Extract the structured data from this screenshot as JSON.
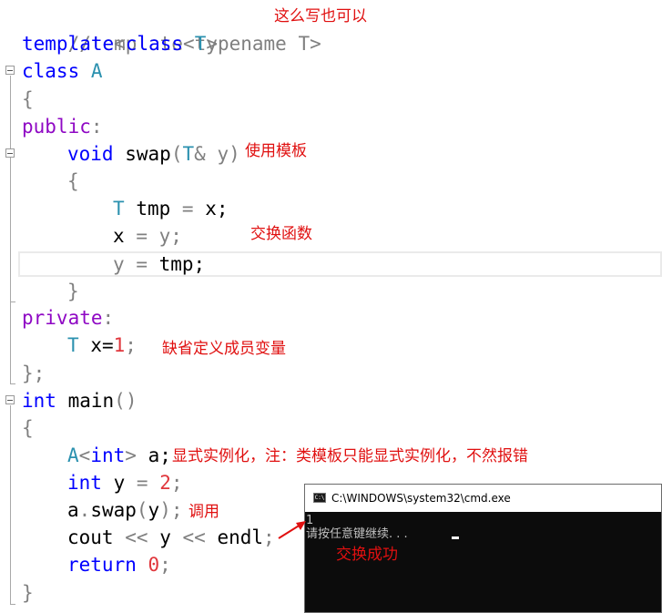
{
  "code": {
    "l1": "//template<typename T>",
    "l2_kw": "template",
    "l2_rest": "<class T>",
    "l3_kw": "class",
    "l3_name": "A",
    "l4": "{",
    "l5_kw": "public",
    "l5_colon": ":",
    "l6_kw": "void",
    "l6_fn": "swap",
    "l6_p1": "(",
    "l6_t": "T",
    "l6_amp": "&",
    "l6_y": "y",
    "l6_p2": ")",
    "l7": "{",
    "l8_t": "T",
    "l8_rest": "tmp",
    "l8_eq": "=",
    "l8_x": "x;",
    "l9_x": "x",
    "l9_eq": "=",
    "l9_y": "y;",
    "l10_y": "y",
    "l10_eq": "=",
    "l10_tmp": "tmp;",
    "l11": "}",
    "l12_kw": "private",
    "l12_colon": ":",
    "l13_t": "T",
    "l13_x": "x=",
    "l13_num": "1",
    "l13_semi": ";",
    "l14": "};",
    "l15_kw": "int",
    "l15_fn": "main",
    "l15_paren": "()",
    "l16": "{",
    "l17_a": "A",
    "l17_lt": "<",
    "l17_int": "int",
    "l17_gt": ">",
    "l17_rest": "a;",
    "l18_kw": "int",
    "l18_y": "y",
    "l18_eq": "=",
    "l18_num": "2",
    "l18_semi": ";",
    "l19_a": "a",
    "l19_dot": ".",
    "l19_fn": "swap",
    "l19_p1": "(",
    "l19_y": "y",
    "l19_p2": ");",
    "l20_cout": "cout",
    "l20_op1": "<<",
    "l20_y": "y",
    "l20_op2": "<<",
    "l20_endl": "endl",
    "l20_semi": ";",
    "l21_kw": "return",
    "l21_num": "0",
    "l21_semi": ";",
    "l22": "}"
  },
  "annotations": {
    "typename_note": "这么写也可以",
    "use_template": "使用模板",
    "swap_func": "交换函数",
    "default_member": "缺省定义成员变量",
    "explicit_inst": "显式实例化，注：类模板只能显式实例化，不然报错",
    "call": "调用",
    "swap_success": "交换成功"
  },
  "console": {
    "title": "C:\\WINDOWS\\system32\\cmd.exe",
    "icon_text": "C:\\",
    "output_line1": "1",
    "output_line2": "请按任意键继续. . ."
  },
  "colors": {
    "keyword": "#8f08c4",
    "type": "#2b91af",
    "number": "#e0363c",
    "comment": "#808080",
    "annotation": "#e01010",
    "console_bg": "#0c0c0c"
  }
}
